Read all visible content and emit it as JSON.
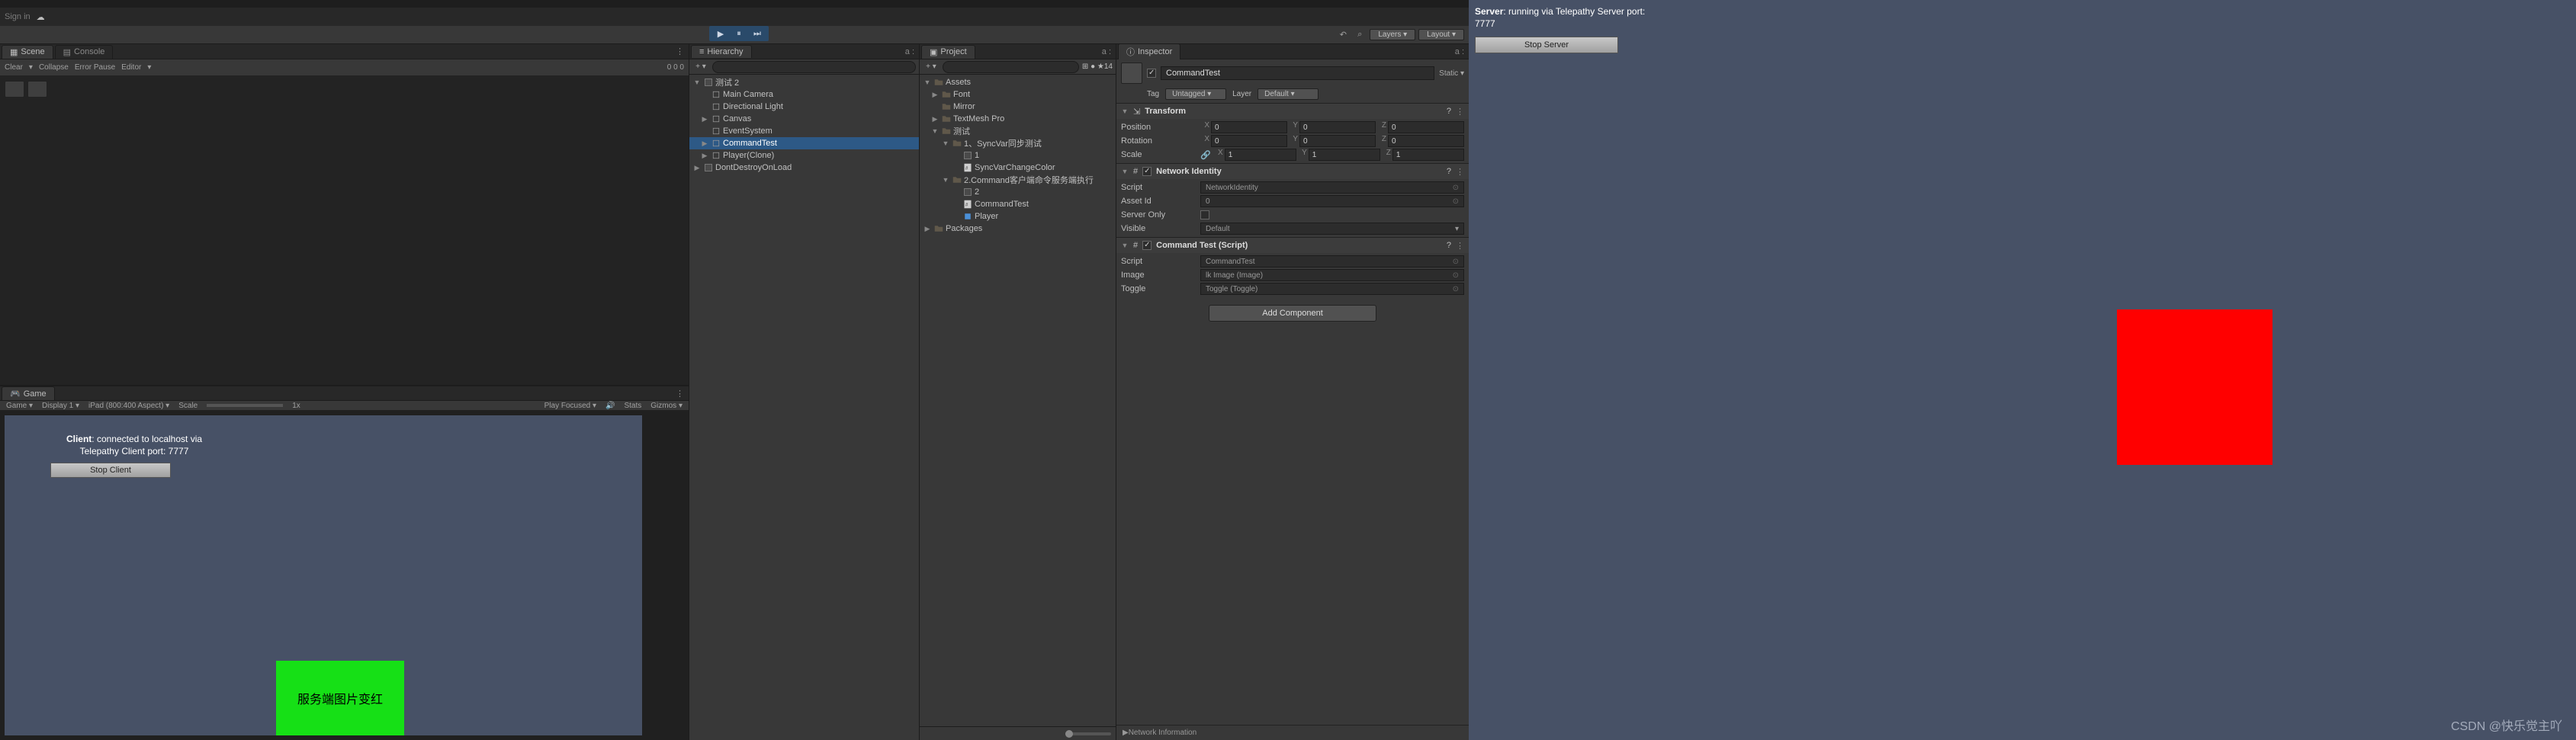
{
  "signin": {
    "label": "Sign in",
    "cloud_icon": "cloud"
  },
  "toolbar": {
    "play_active": true,
    "tools": {
      "search": "⌕",
      "layers": "Layers",
      "layout": "Layout"
    }
  },
  "scene": {
    "tabs": [
      "Scene",
      "Console"
    ],
    "toolbar": {
      "clear": "Clear",
      "collapse": "Collapse",
      "error_pause": "Error Pause",
      "editor": "Editor"
    },
    "counters": "0  0  0"
  },
  "game": {
    "tab": "Game",
    "toolbar": {
      "mode": "Game",
      "display": "Display 1",
      "aspect": "iPad (800:400 Aspect)",
      "scale": "Scale",
      "scale_val": "1x",
      "play_focused": "Play Focused",
      "mute": "",
      "stats": "Stats",
      "gizmos": "Gizmos"
    },
    "status_l1a": "Client",
    "status_l1b": ": connected to localhost via",
    "status_l2": "Telepathy Client port: 7777",
    "stop": "Stop Client",
    "green_text": "服务端图片变红"
  },
  "hierarchy": {
    "tab": "Hierarchy",
    "search_ph": "",
    "right_label": "a :",
    "items": [
      {
        "l": 0,
        "t": "scene",
        "fold": "▼",
        "n": "测试 2"
      },
      {
        "l": 1,
        "t": "go",
        "n": "Main Camera"
      },
      {
        "l": 1,
        "t": "go",
        "n": "Directional Light"
      },
      {
        "l": 1,
        "t": "go",
        "fold": "▶",
        "n": "Canvas"
      },
      {
        "l": 1,
        "t": "go",
        "n": "EventSystem"
      },
      {
        "l": 1,
        "t": "go",
        "fold": "▶",
        "n": "CommandTest",
        "sel": true
      },
      {
        "l": 1,
        "t": "go",
        "fold": "▶",
        "n": "Player(Clone)"
      },
      {
        "l": 0,
        "t": "scene",
        "fold": "▶",
        "n": "DontDestroyOnLoad"
      }
    ]
  },
  "project": {
    "tab": "Project",
    "right_label": "a :",
    "search_ph": "",
    "icons": "⊞ ● ★14",
    "items": [
      {
        "l": 0,
        "t": "folder",
        "fold": "▼",
        "n": "Assets"
      },
      {
        "l": 1,
        "t": "folder",
        "fold": "▶",
        "n": "Font"
      },
      {
        "l": 1,
        "t": "folder",
        "n": "Mirror"
      },
      {
        "l": 1,
        "t": "folder",
        "fold": "▶",
        "n": "TextMesh Pro"
      },
      {
        "l": 1,
        "t": "folder",
        "fold": "▼",
        "n": "测试"
      },
      {
        "l": 2,
        "t": "folder",
        "fold": "▼",
        "n": "1、SyncVar同步测试"
      },
      {
        "l": 3,
        "t": "scene",
        "n": "1"
      },
      {
        "l": 3,
        "t": "cs",
        "n": "SyncVarChangeColor"
      },
      {
        "l": 2,
        "t": "folder",
        "fold": "▼",
        "n": "2.Command客户端命令服务端执行"
      },
      {
        "l": 3,
        "t": "scene",
        "n": "2"
      },
      {
        "l": 3,
        "t": "cs",
        "n": "CommandTest"
      },
      {
        "l": 3,
        "t": "prefab",
        "n": "Player"
      },
      {
        "l": 0,
        "t": "folder",
        "fold": "▶",
        "n": "Packages"
      }
    ]
  },
  "inspector": {
    "tab": "Inspector",
    "lock": "a :",
    "name": "CommandTest",
    "static": "Static",
    "tag_label": "Tag",
    "tag": "Untagged",
    "layer_label": "Layer",
    "layer": "Default",
    "transform": {
      "title": "Transform",
      "rows": [
        {
          "label": "Position",
          "x": "0",
          "y": "0",
          "z": "0"
        },
        {
          "label": "Rotation",
          "x": "0",
          "y": "0",
          "z": "0"
        },
        {
          "label": "Scale",
          "lock": true,
          "x": "1",
          "y": "1",
          "z": "1"
        }
      ]
    },
    "netid": {
      "title": "Network Identity",
      "rows": [
        {
          "label": "Script",
          "val": "NetworkIdentity",
          "ro": true
        },
        {
          "label": "Asset Id",
          "val": "0"
        },
        {
          "label": "Server Only",
          "chk": false
        },
        {
          "label": "Visible",
          "dd": "Default"
        }
      ]
    },
    "cmdtest": {
      "title": "Command Test (Script)",
      "rows": [
        {
          "label": "Script",
          "val": "CommandTest",
          "ro": true
        },
        {
          "label": "Image",
          "val": "lk Image (Image)"
        },
        {
          "label": "Toggle",
          "val": "Toggle (Toggle)"
        }
      ]
    },
    "addcomp": "Add Component",
    "netinfo": "Network Information"
  },
  "server": {
    "l1a": "Server",
    "l1b": ": running via Telepathy Server port:",
    "l2": "7777",
    "stop": "Stop Server"
  },
  "watermark": "CSDN @快乐觉主吖"
}
